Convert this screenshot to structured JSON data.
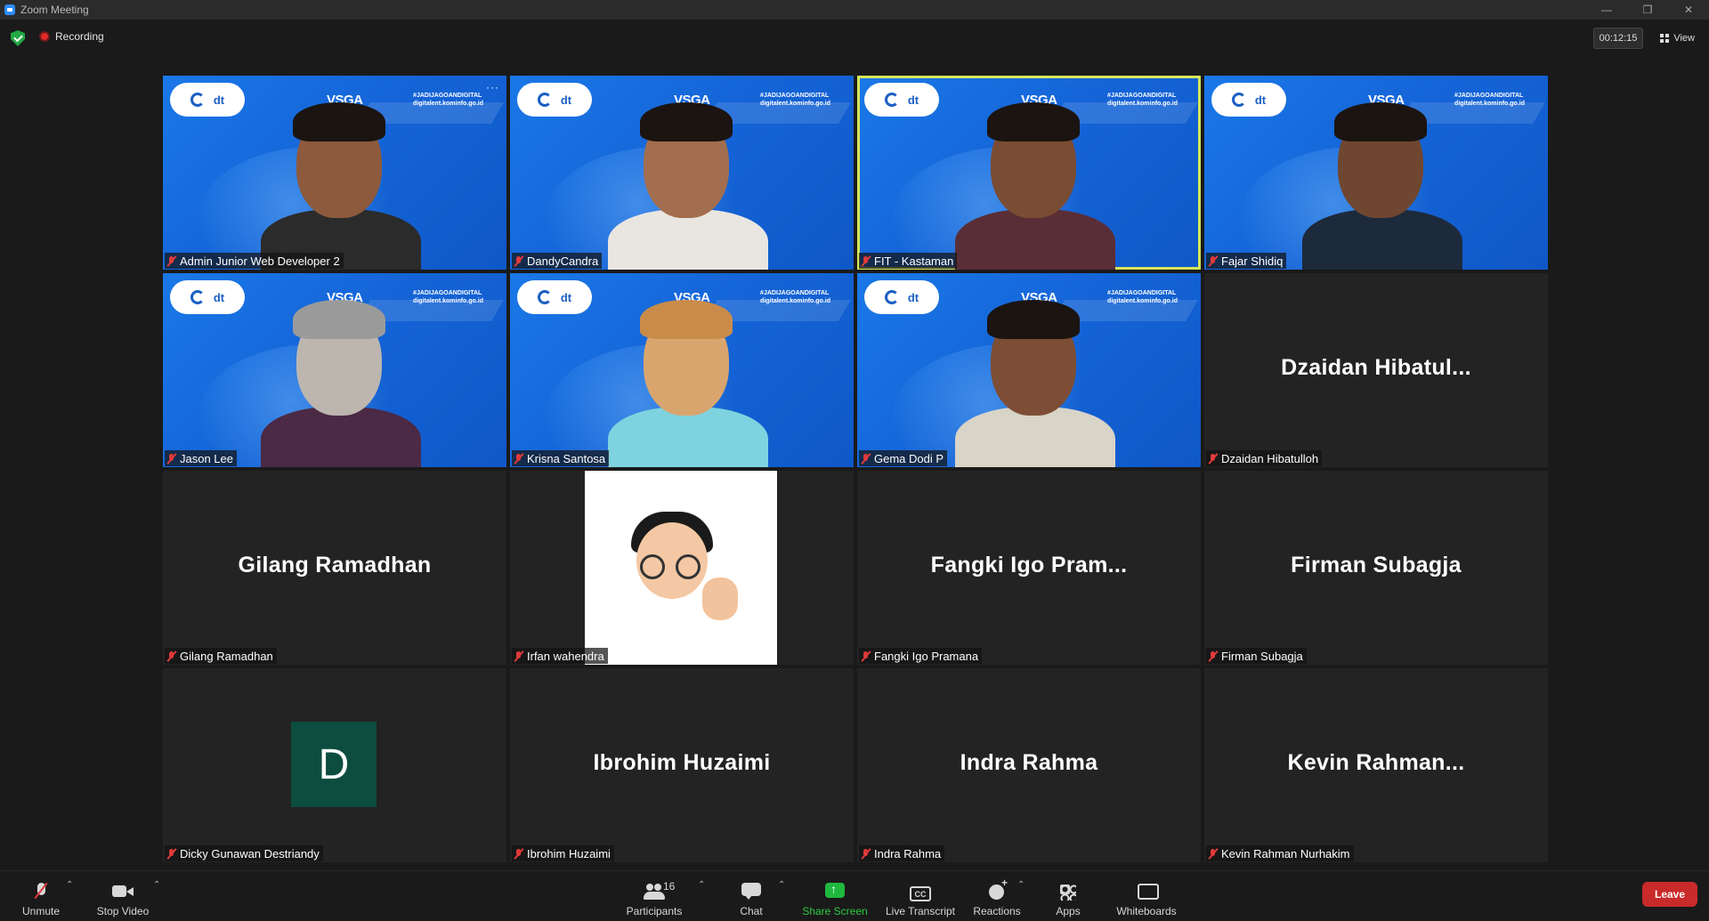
{
  "window": {
    "title": "Zoom Meeting"
  },
  "status": {
    "recording_label": "Recording",
    "timer": "00:12:15",
    "view_label": "View"
  },
  "tiles": [
    {
      "name": "Admin Junior Web Developer 2",
      "type": "video"
    },
    {
      "name": "DandyCandra",
      "type": "video"
    },
    {
      "name": "FIT - Kastaman",
      "type": "video",
      "active": true
    },
    {
      "name": "Fajar Shidiq",
      "type": "video"
    },
    {
      "name": "Jason Lee",
      "type": "video"
    },
    {
      "name": "Krisna Santosa",
      "type": "video"
    },
    {
      "name": "Gema Dodi P",
      "type": "video"
    },
    {
      "name": "Dzaidan Hibatulloh",
      "display": "Dzaidan  Hibatul...",
      "type": "name"
    },
    {
      "name": "Gilang Ramadhan",
      "display": "Gilang Ramadhan",
      "type": "name"
    },
    {
      "name": "Irfan wahendra",
      "type": "picture"
    },
    {
      "name": "Fangki Igo Pramana",
      "display": "Fangki  Igo  Pram...",
      "type": "name"
    },
    {
      "name": "Firman Subagja",
      "display": "Firman  Subagja",
      "type": "name"
    },
    {
      "name": "Dicky Gunawan Destriandy",
      "initial": "D",
      "type": "initial"
    },
    {
      "name": "Ibrohim Huzaimi",
      "display": "Ibrohim  Huzaimi",
      "type": "name"
    },
    {
      "name": "Indra Rahma",
      "display": "Indra  Rahma",
      "type": "name"
    },
    {
      "name": "Kevin Rahman Nurhakim",
      "display": "Kevin  Rahman...",
      "type": "name"
    }
  ],
  "background": {
    "vsga": "VSGA",
    "tag_line1": "#JADIJAGOANDIGITAL",
    "tag_line2": "digitalent.kominfo.go.id",
    "digitalent": "dt"
  },
  "toolbar": {
    "unmute": "Unmute",
    "stop_video": "Stop Video",
    "participants": "Participants",
    "participants_count": "16",
    "chat": "Chat",
    "share_screen": "Share Screen",
    "live_transcript": "Live Transcript",
    "reactions": "Reactions",
    "apps": "Apps",
    "whiteboards": "Whiteboards",
    "leave": "Leave",
    "cc_icon_text": "CC"
  },
  "colors": {
    "leave": "#c92a2a",
    "share": "#1fb83f",
    "active_speaker": "#d7e75a",
    "tile_bg": "#232323"
  },
  "icons": {
    "security": "shield-check-icon",
    "recording": "record-dot-icon",
    "view": "grid-icon"
  }
}
